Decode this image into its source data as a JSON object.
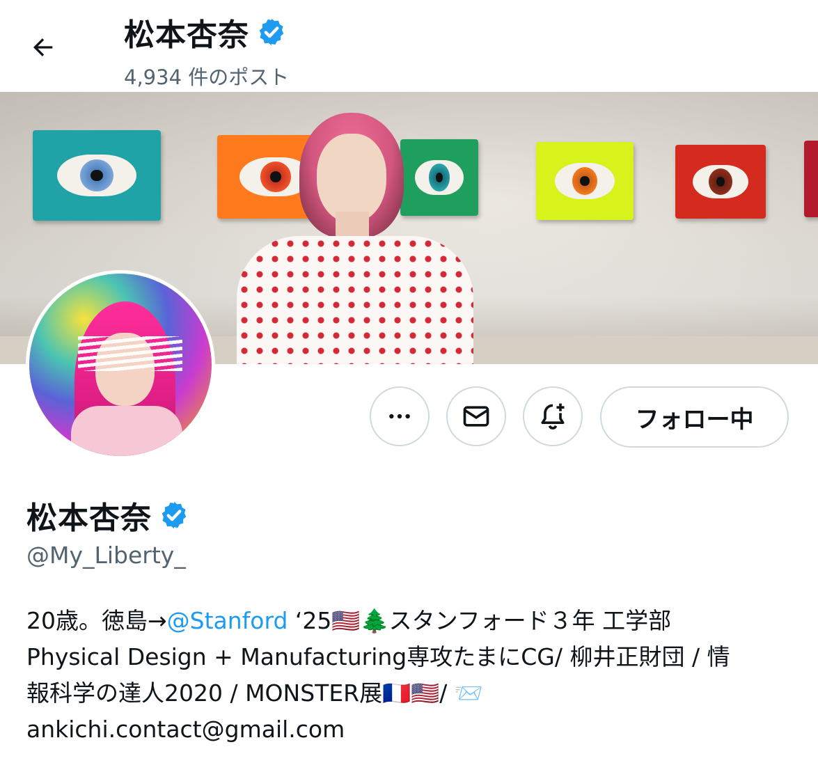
{
  "header": {
    "display_name": "松本杏奈",
    "posts_count": "4,934 件のポスト"
  },
  "profile": {
    "display_name": "松本杏奈",
    "handle": "@My_Liberty_",
    "verified": true,
    "bio": {
      "line1_prefix": "20歳。徳島→",
      "line1_mention": "@Stanford",
      "line1_suffix": " ‘25🇺🇸🌲スタンフォード３年 工学部",
      "line2": "Physical Design + Manufacturing専攻たまにCG/ 柳井正財団 / 情",
      "line3": "報科学の達人2020 / MONSTER展🇫🇷🇺🇸/ 📨",
      "line4": "ankichi.contact@gmail.com"
    }
  },
  "actions": {
    "follow_label": "フォロー中"
  },
  "icons": [
    "back-arrow-icon",
    "verified-badge-icon",
    "more-icon",
    "message-icon",
    "notification-bell-add-icon"
  ],
  "colors": {
    "accent": "#1d9bf0",
    "text": "#0f1419",
    "secondary_text": "#536471",
    "border": "#cfd9de"
  }
}
